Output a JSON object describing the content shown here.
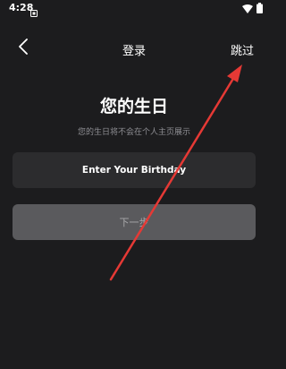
{
  "status_bar": {
    "time": "4:28",
    "icons": [
      "notification-icon",
      "wifi-icon",
      "battery-icon"
    ]
  },
  "nav": {
    "back_icon": "chevron-left-icon",
    "title": "登录",
    "skip_label": "跳过"
  },
  "content": {
    "heading": "您的生日",
    "subheading": "您的生日将不会在个人主页展示",
    "birthday_placeholder": "Enter Your Birthday",
    "next_label": "下一步"
  },
  "colors": {
    "background": "#1c1c1e",
    "field_bg": "#2c2c2e",
    "button_disabled_bg": "#5a5a5d",
    "annotation_arrow": "#e53935"
  }
}
